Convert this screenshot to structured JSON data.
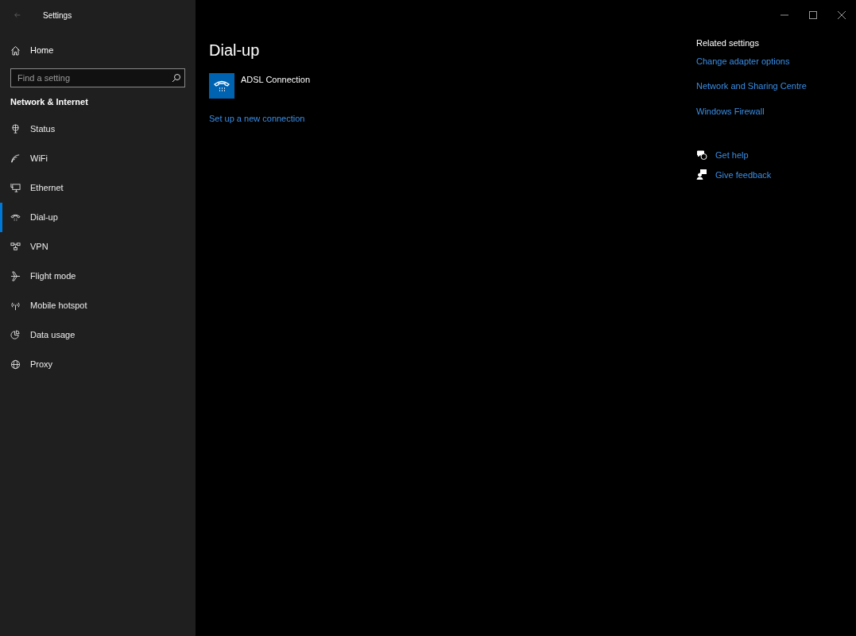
{
  "window": {
    "title": "Settings"
  },
  "sidebar": {
    "home": "Home",
    "search": {
      "placeholder": "Find a setting"
    },
    "section": "Network & Internet",
    "items": [
      {
        "label": "Status",
        "selected": false
      },
      {
        "label": "WiFi",
        "selected": false
      },
      {
        "label": "Ethernet",
        "selected": false
      },
      {
        "label": "Dial-up",
        "selected": true
      },
      {
        "label": "VPN",
        "selected": false
      },
      {
        "label": "Flight mode",
        "selected": false
      },
      {
        "label": "Mobile hotspot",
        "selected": false
      },
      {
        "label": "Data usage",
        "selected": false
      },
      {
        "label": "Proxy",
        "selected": false
      }
    ]
  },
  "main": {
    "heading": "Dial-up",
    "connections": [
      {
        "name": "ADSL Connection"
      }
    ],
    "setup_link": "Set up a new connection"
  },
  "related": {
    "heading": "Related settings",
    "links": [
      "Change adapter options",
      "Network and Sharing Centre",
      "Windows Firewall"
    ],
    "help": [
      {
        "kind": "help",
        "label": "Get help"
      },
      {
        "kind": "feedback",
        "label": "Give feedback"
      }
    ]
  }
}
